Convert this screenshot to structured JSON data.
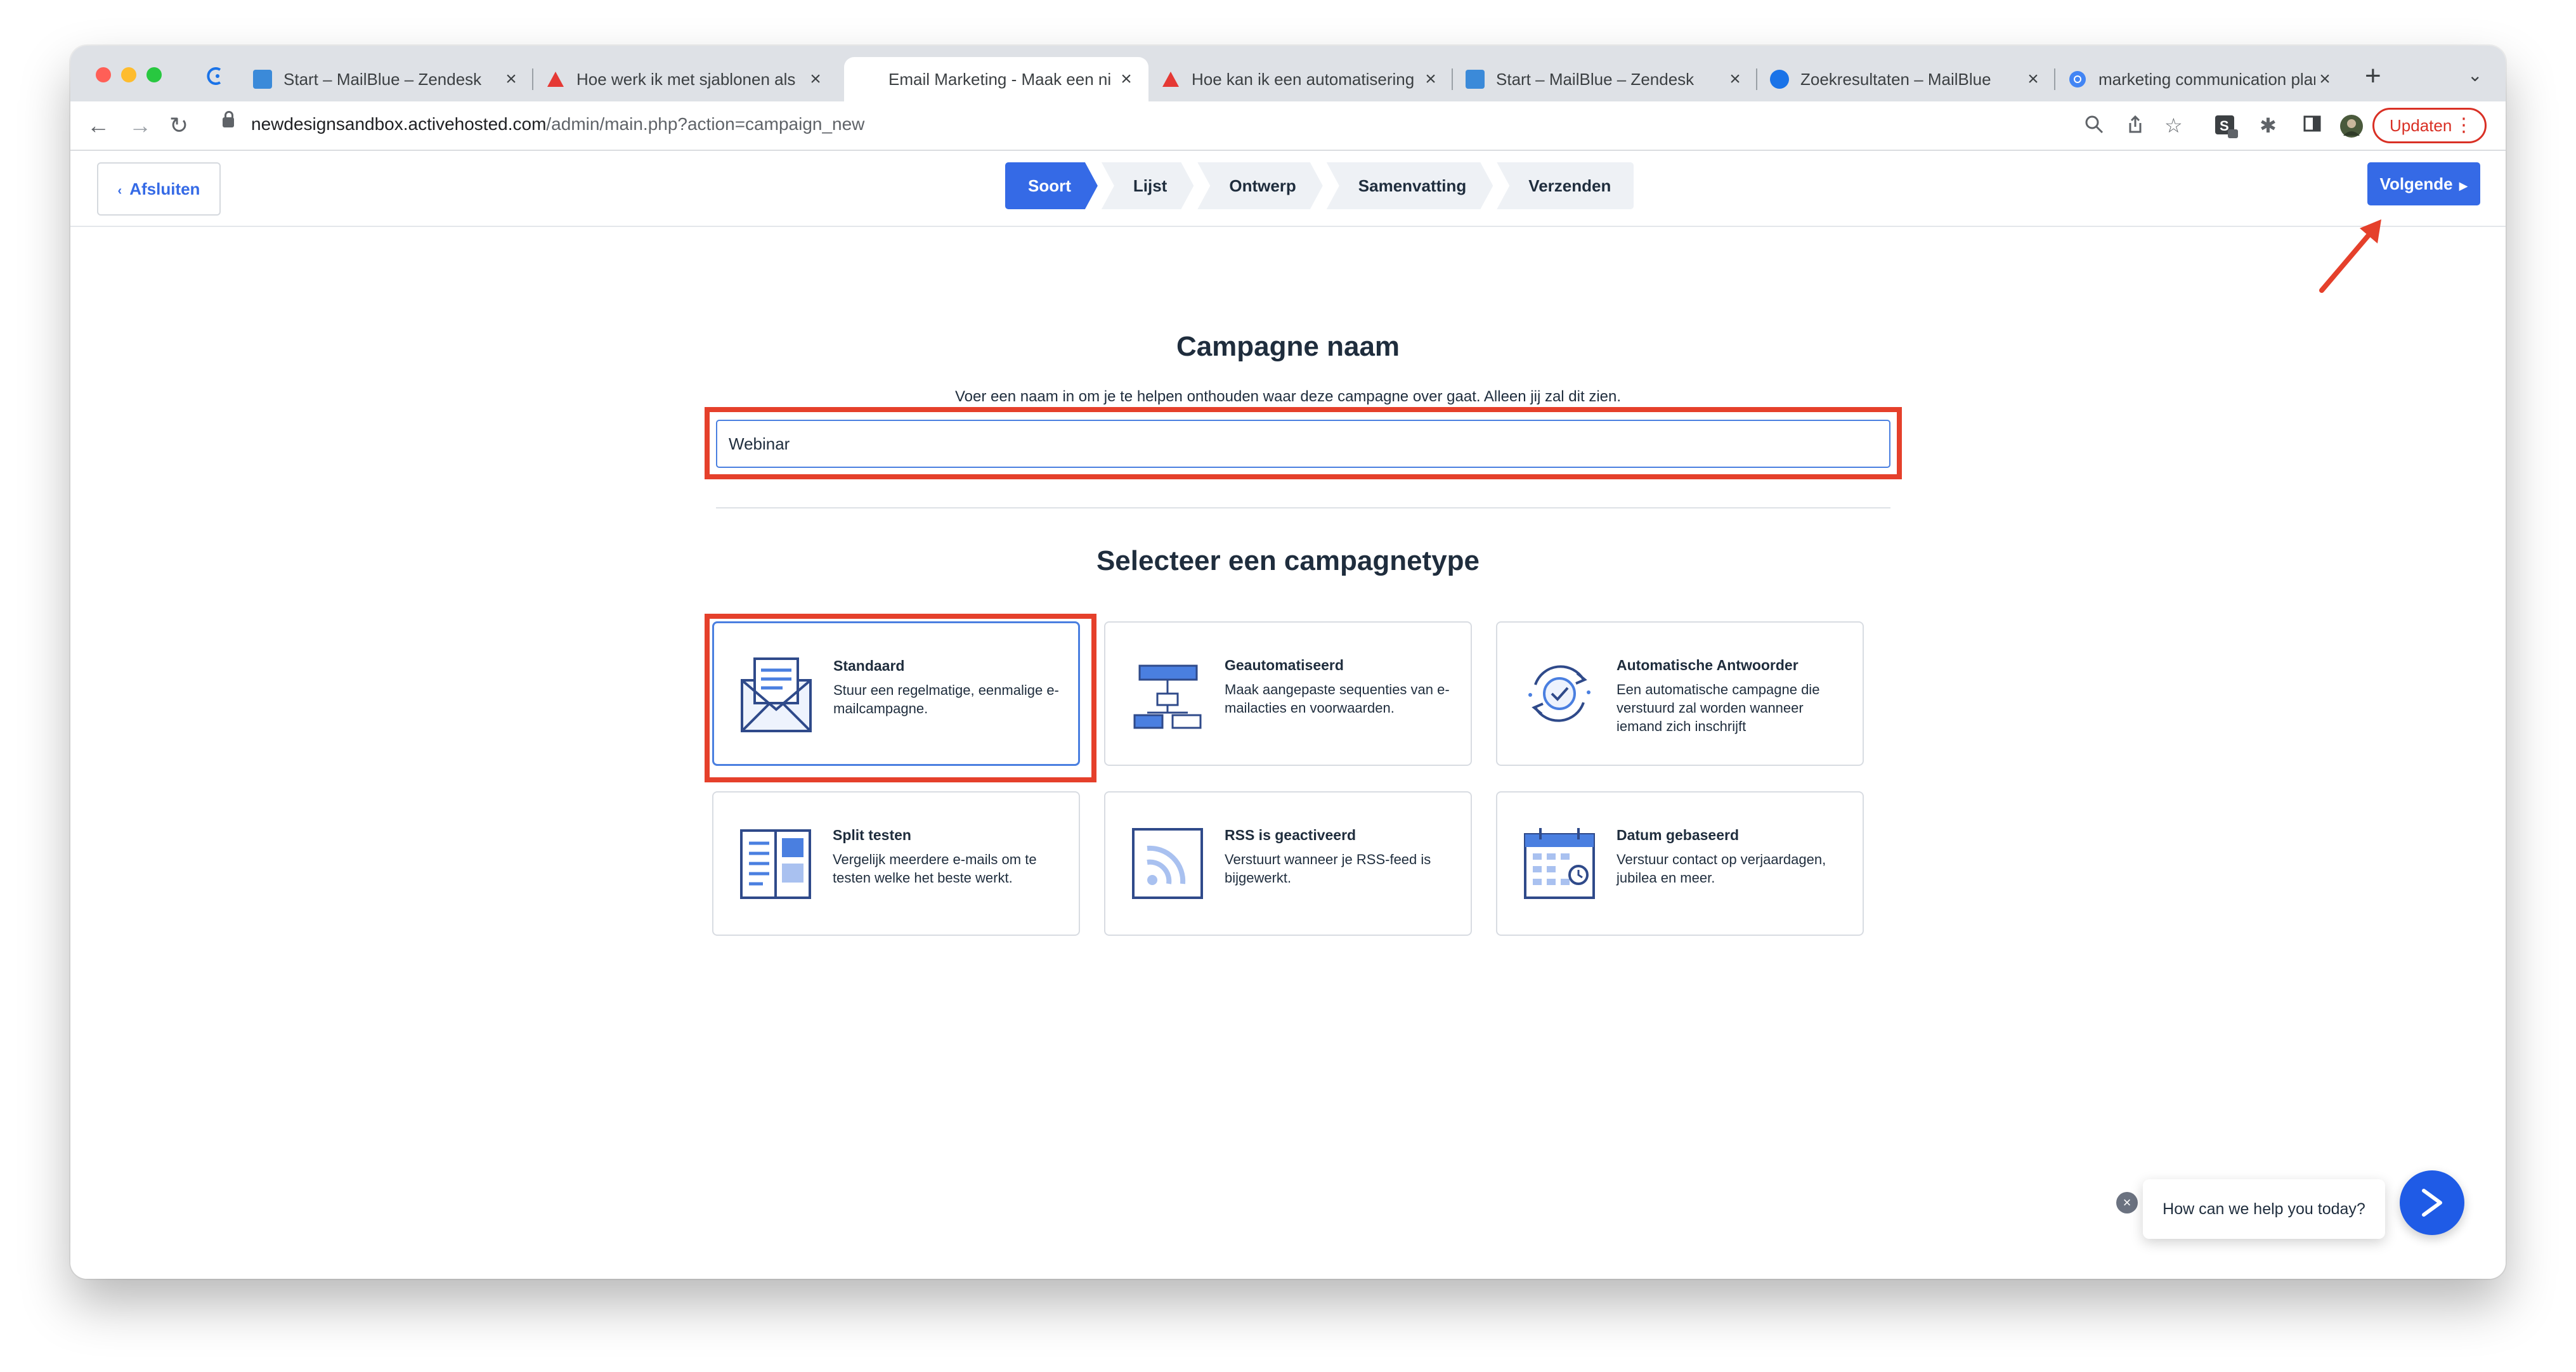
{
  "browser": {
    "tabs": [
      {
        "title": "Start – MailBlue – Zendesk",
        "favicon": "mailblue-icon",
        "active": false
      },
      {
        "title": "Hoe werk ik met sjablonen als",
        "favicon": "zendesk-icon",
        "active": false
      },
      {
        "title": "Email Marketing - Maak een ni",
        "favicon": "none",
        "active": true
      },
      {
        "title": "Hoe kan ik een automatisering",
        "favicon": "zendesk-icon",
        "active": false
      },
      {
        "title": "Start – MailBlue – Zendesk",
        "favicon": "mailblue-icon",
        "active": false
      },
      {
        "title": "Zoekresultaten – MailBlue",
        "favicon": "mailblue-circle-icon",
        "active": false
      },
      {
        "title": "marketing communication plan",
        "favicon": "chrome-icon",
        "active": false
      }
    ],
    "url_host": "newdesignsandbox.activehosted.com",
    "url_path": "/admin/main.php?action=campaign_new",
    "update_label": "Updaten"
  },
  "header": {
    "exit_label": "Afsluiten",
    "steps": [
      "Soort",
      "Lijst",
      "Ontwerp",
      "Samenvatting",
      "Verzenden"
    ],
    "active_step": "Soort",
    "next_label": "Volgende"
  },
  "campaign_name": {
    "title": "Campagne naam",
    "subtitle": "Voer een naam in om je te helpen onthouden waar deze campagne over gaat. Alleen jij zal dit zien.",
    "value": "Webinar"
  },
  "campaign_type": {
    "title": "Selecteer een campagnetype",
    "cards": [
      {
        "title": "Standaard",
        "desc": "Stuur een regelmatige, eenmalige e-mailcampagne.",
        "icon": "envelope-icon",
        "selected": true
      },
      {
        "title": "Geautomatiseerd",
        "desc": "Maak aangepaste sequenties van e-mailacties en voorwaarden.",
        "icon": "flowchart-icon",
        "selected": false
      },
      {
        "title": "Automatische Antwoorder",
        "desc": "Een automatische campagne die verstuurd zal worden wanneer iemand zich inschrijft",
        "icon": "auto-cycle-icon",
        "selected": false
      },
      {
        "title": "Split testen",
        "desc": "Vergelijk meerdere e-mails om te testen welke het beste werkt.",
        "icon": "split-test-icon",
        "selected": false
      },
      {
        "title": "RSS is geactiveerd",
        "desc": "Verstuurt wanneer je RSS-feed is bijgewerkt.",
        "icon": "rss-icon",
        "selected": false
      },
      {
        "title": "Datum gebaseerd",
        "desc": "Verstuur contact op verjaardagen, jubilea en meer.",
        "icon": "calendar-icon",
        "selected": false
      }
    ]
  },
  "chat": {
    "prompt": "How can we help you today?"
  },
  "colors": {
    "accent": "#356ae6",
    "annotation": "#e5402b"
  }
}
